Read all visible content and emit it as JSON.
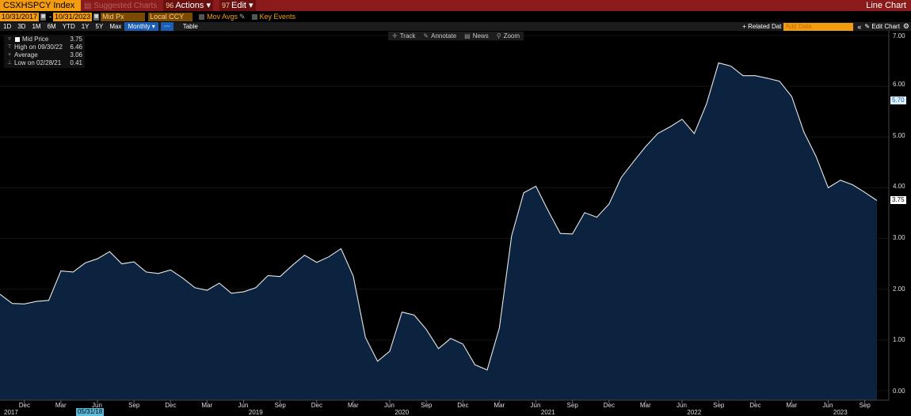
{
  "topbar": {
    "ticker": "CSXHSPCY Index",
    "suggested": "Suggested Charts",
    "actions_num": "96",
    "actions": "Actions",
    "edit_num": "97",
    "edit": "Edit",
    "title": "Line Chart"
  },
  "params": {
    "start_date": "10/31/2017",
    "end_date": "10/31/2023",
    "field": "Mid Px",
    "currency": "Local CCY",
    "mov_avgs": "Mov Avgs",
    "key_events": "Key Events"
  },
  "range": {
    "buttons": [
      "1D",
      "3D",
      "1M",
      "6M",
      "YTD",
      "1Y",
      "5Y",
      "Max"
    ],
    "period": "Monthly",
    "table": "Table",
    "related": "Related Dat",
    "add_data_placeholder": "Add Data",
    "edit_chart": "Edit Chart"
  },
  "tools": {
    "track": "Track",
    "annotate": "Annotate",
    "news": "News",
    "zoom": "Zoom"
  },
  "legend": {
    "mid_label": "Mid Price",
    "mid_value": "3.75",
    "high_label": "High on 09/30/22",
    "high_value": "6.46",
    "avg_label": "Average",
    "avg_value": "3.06",
    "low_label": "Low on 02/28/21",
    "low_value": "0.41"
  },
  "axis": {
    "y_ticks": [
      "0.00",
      "1.00",
      "2.00",
      "3.00",
      "4.00",
      "5.00",
      "6.00",
      "7.00"
    ],
    "last_tag": "3.75",
    "other_tag": "5.70",
    "highlight_date": "05/31/18",
    "month_ticks": [
      "Dec",
      "Mar",
      "Jun",
      "Sep",
      "Dec",
      "Mar",
      "Jun",
      "Sep",
      "Dec",
      "Mar",
      "Jun",
      "Sep",
      "Dec",
      "Mar",
      "Jun",
      "Sep",
      "Dec",
      "Mar",
      "Jun",
      "Sep",
      "Dec",
      "Mar",
      "Jun",
      "Sep"
    ],
    "years": [
      "2017",
      "2019",
      "2020",
      "2021",
      "2022",
      "2023"
    ]
  },
  "colors": {
    "fill": "#0c2340",
    "line": "#e8e8e8",
    "accent": "#f39c12",
    "topbar": "#8b1a1a"
  },
  "chart_data": {
    "type": "area",
    "x_start": "2017-10",
    "frequency": "monthly",
    "ylim": [
      0,
      7
    ],
    "values": [
      1.9,
      1.72,
      1.71,
      1.76,
      1.78,
      2.36,
      2.34,
      2.52,
      2.6,
      2.74,
      2.5,
      2.54,
      2.34,
      2.31,
      2.38,
      2.22,
      2.03,
      1.98,
      2.12,
      1.92,
      1.95,
      2.03,
      2.27,
      2.25,
      2.47,
      2.67,
      2.53,
      2.64,
      2.8,
      2.26,
      1.05,
      0.58,
      0.78,
      1.55,
      1.49,
      1.21,
      0.83,
      1.03,
      0.92,
      0.51,
      0.41,
      1.24,
      3.05,
      3.9,
      4.03,
      3.55,
      3.1,
      3.09,
      3.51,
      3.42,
      3.68,
      4.2,
      4.51,
      4.81,
      5.07,
      5.2,
      5.35,
      5.07,
      5.65,
      6.46,
      6.4,
      6.21,
      6.21,
      6.16,
      6.1,
      5.8,
      5.1,
      4.62,
      4.0,
      4.15,
      4.06,
      3.91,
      3.75
    ]
  }
}
